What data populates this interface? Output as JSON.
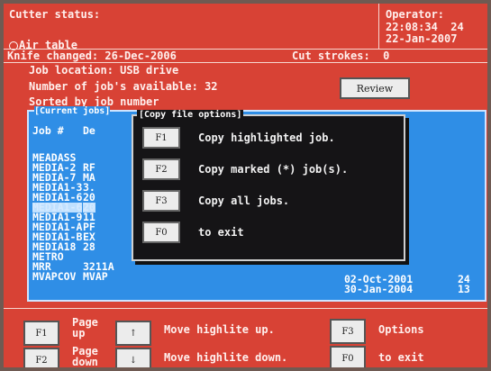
{
  "header": {
    "cutter_status": "Cutter status:",
    "air_table": "Air table",
    "operator_label": "Operator:",
    "time": "22:08:34  24",
    "date": "22-Jan-2007",
    "knife_changed": "Knife changed: 26-Dec-2006",
    "cut_strokes": "Cut strokes:  0"
  },
  "info": {
    "job_location": "Job location: USB drive",
    "jobs_available": "Number of job's available: 32",
    "sorted_by": "Sorted by job number",
    "review_label": "Review"
  },
  "joblist": {
    "title": "[Current jobs]",
    "col_job": "Job #",
    "col_de": "De",
    "rows": [
      {
        "job": "MEADASS",
        "desc": ""
      },
      {
        "job": "MEDIA-2",
        "desc": "RF"
      },
      {
        "job": "MEDIA-7",
        "desc": "MA"
      },
      {
        "job": "MEDIA1-3",
        "desc": "3."
      },
      {
        "job": "MEDIA1-6",
        "desc": "20"
      },
      {
        "job": "MEDIA1-6",
        "desc": "20"
      },
      {
        "job": "MEDIA1-9",
        "desc": "11"
      },
      {
        "job": "MEDIA1-A",
        "desc": "PF"
      },
      {
        "job": "MEDIA1-B",
        "desc": "EX"
      },
      {
        "job": "MEDIA18",
        "desc": "28"
      },
      {
        "job": "METRO",
        "desc": ""
      },
      {
        "job": "MRR",
        "desc": "3211A"
      },
      {
        "job": "MVAPCOV",
        "desc": "MVAP"
      }
    ],
    "right_rows": [
      {
        "date": "02-Oct-2001",
        "num": "24"
      },
      {
        "date": "30-Jan-2004",
        "num": "13"
      }
    ]
  },
  "dialog": {
    "title": "[Copy file options]",
    "options": [
      {
        "key": "F1",
        "label": "Copy highlighted job."
      },
      {
        "key": "F2",
        "label": "Copy marked (*) job(s)."
      },
      {
        "key": "F3",
        "label": "Copy all jobs."
      },
      {
        "key": "F0",
        "label": "to exit"
      }
    ]
  },
  "bottom": {
    "f1_key": "F1",
    "page_up": "Page\nup",
    "up_key": "↑",
    "move_up": "Move highlite up.",
    "f3_key": "F3",
    "options": "Options",
    "f2_key": "F2",
    "page_down": "Page\ndown",
    "down_key": "↓",
    "move_down": "Move highlite down.",
    "f0_key": "F0",
    "to_exit": "to exit"
  }
}
